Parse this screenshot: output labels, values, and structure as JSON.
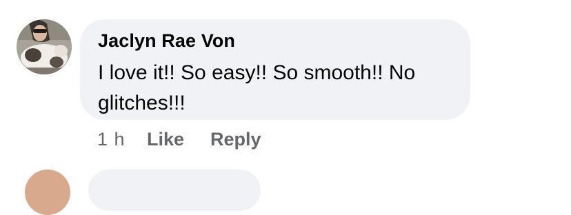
{
  "comment": {
    "author": "Jaclyn Rae Von",
    "text": "I love it!! So easy!! So smooth!! No glitches!!!",
    "timestamp": "1 h",
    "like_label": "Like",
    "reply_label": "Reply"
  },
  "colors": {
    "bubble_background": "#f0f2f5",
    "primary_text": "#050505",
    "secondary_text": "#65676b"
  }
}
